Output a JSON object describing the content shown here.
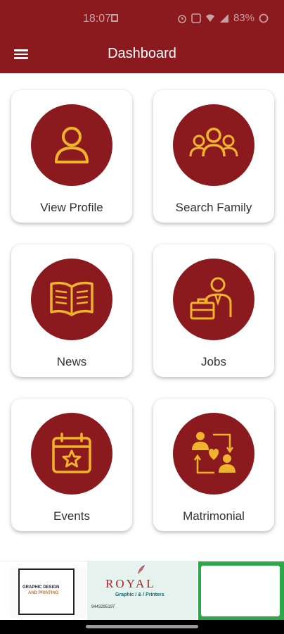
{
  "status_bar": {
    "time": "18:07",
    "battery": "83%"
  },
  "app_bar": {
    "title": "Dashboard",
    "menu_icon": "hamburger-menu-icon"
  },
  "tiles": [
    {
      "label": "View Profile",
      "icon": "user-icon"
    },
    {
      "label": "Search Family",
      "icon": "users-group-icon"
    },
    {
      "label": "News",
      "icon": "open-book-icon"
    },
    {
      "label": "Jobs",
      "icon": "businessman-briefcase-icon"
    },
    {
      "label": "Events",
      "icon": "calendar-star-icon"
    },
    {
      "label": "Matrimonial",
      "icon": "couple-heart-icon"
    }
  ],
  "ad": {
    "left_line1": "GRAPHIC DESIGN",
    "left_line2": "AND PRINTING",
    "brand": "ROYAL",
    "subtitle": "Graphic / & / Printers",
    "phone": "9443295197"
  },
  "colors": {
    "primary": "#8b1a1f",
    "icon_gold": "#f0b42c",
    "card_bg": "#ffffff"
  }
}
